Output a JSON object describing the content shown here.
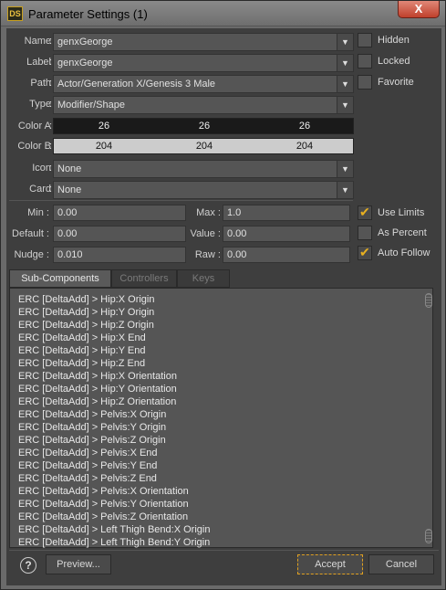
{
  "window": {
    "title": "Parameter Settings (1)",
    "app_icon": "DS",
    "close": "X"
  },
  "fields": {
    "name": {
      "label": "Name",
      "value": "genxGeorge"
    },
    "label": {
      "label": "Label",
      "value": "genxGeorge"
    },
    "path": {
      "label": "Path",
      "value": "Actor/Generation X/Genesis 3 Male"
    },
    "type": {
      "label": "Type",
      "value": "Modifier/Shape"
    },
    "color_a": {
      "label": "Color A",
      "r": "26",
      "g": "26",
      "b": "26",
      "hex": "#1a1a1a"
    },
    "color_b": {
      "label": "Color B",
      "r": "204",
      "g": "204",
      "b": "204",
      "hex": "#cccccc"
    },
    "icon": {
      "label": "Icon",
      "value": "None"
    },
    "card": {
      "label": "Card",
      "value": "None"
    }
  },
  "flags": {
    "hidden": "Hidden",
    "locked": "Locked",
    "favorite": "Favorite"
  },
  "numeric": {
    "min": {
      "label": "Min",
      "value": "0.00"
    },
    "max": {
      "label": "Max",
      "value": "1.0"
    },
    "default": {
      "label": "Default",
      "value": "0.00"
    },
    "value": {
      "label": "Value",
      "value": "0.00"
    },
    "nudge": {
      "label": "Nudge",
      "value": "0.010"
    },
    "raw": {
      "label": "Raw",
      "value": "0.00"
    }
  },
  "options": {
    "use_limits": {
      "label": "Use Limits",
      "checked": true
    },
    "as_percent": {
      "label": "As Percent",
      "checked": false
    },
    "auto_follow": {
      "label": "Auto Follow",
      "checked": true
    }
  },
  "tabs": [
    "Sub-Components",
    "Controllers",
    "Keys"
  ],
  "sub_components": [
    "ERC [DeltaAdd] > Hip:X Origin",
    "ERC [DeltaAdd] > Hip:Y Origin",
    "ERC [DeltaAdd] > Hip:Z Origin",
    "ERC [DeltaAdd] > Hip:X End",
    "ERC [DeltaAdd] > Hip:Y End",
    "ERC [DeltaAdd] > Hip:Z End",
    "ERC [DeltaAdd] > Hip:X Orientation",
    "ERC [DeltaAdd] > Hip:Y Orientation",
    "ERC [DeltaAdd] > Hip:Z Orientation",
    "ERC [DeltaAdd] > Pelvis:X Origin",
    "ERC [DeltaAdd] > Pelvis:Y Origin",
    "ERC [DeltaAdd] > Pelvis:Z Origin",
    "ERC [DeltaAdd] > Pelvis:X End",
    "ERC [DeltaAdd] > Pelvis:Y End",
    "ERC [DeltaAdd] > Pelvis:Z End",
    "ERC [DeltaAdd] > Pelvis:X Orientation",
    "ERC [DeltaAdd] > Pelvis:Y Orientation",
    "ERC [DeltaAdd] > Pelvis:Z Orientation",
    "ERC [DeltaAdd] > Left Thigh Bend:X Origin",
    "ERC [DeltaAdd] > Left Thigh Bend:Y Origin"
  ],
  "footer": {
    "help": "?",
    "preview": "Preview...",
    "accept": "Accept",
    "cancel": "Cancel"
  }
}
